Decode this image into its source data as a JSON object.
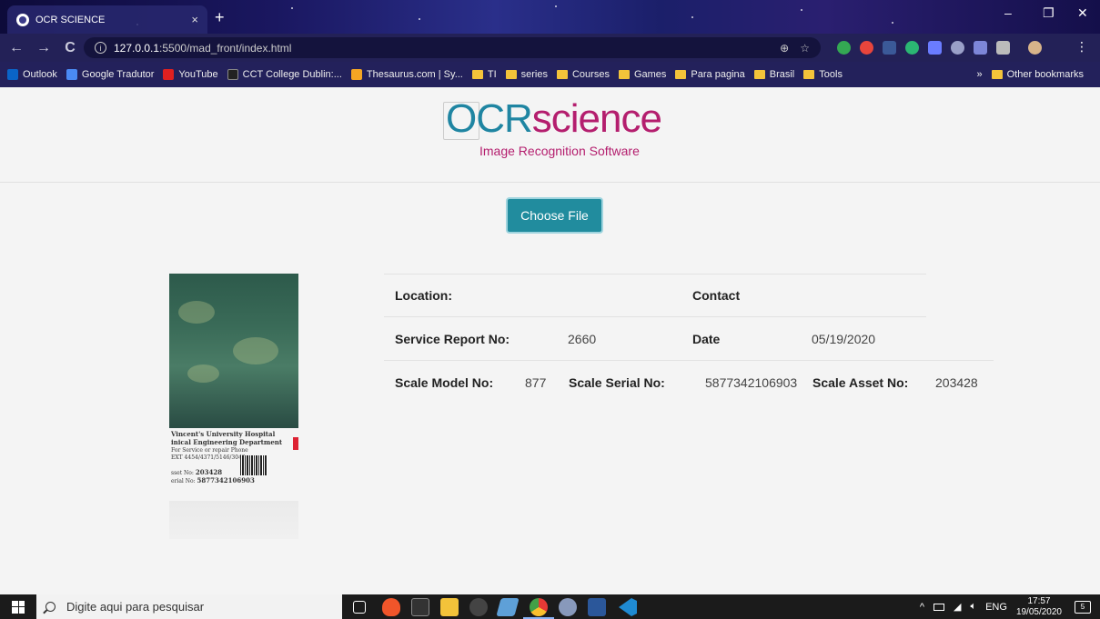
{
  "browser": {
    "tab_title": "OCR SCIENCE",
    "tab_close": "×",
    "new_tab": "+",
    "url_host": "127.0.0.1",
    "url_rest": ":5500/mad_front/index.html",
    "info_icon": "i",
    "nav": {
      "back": "←",
      "forward": "→",
      "reload": "C"
    },
    "window_controls": {
      "minimize": "–",
      "restore": "❐",
      "close": "✕"
    },
    "bookmarks": [
      {
        "label": "Outlook",
        "color": "#0a64c8"
      },
      {
        "label": "Google Tradutor",
        "color": "#4a8af4"
      },
      {
        "label": "YouTube",
        "color": "#e02020"
      },
      {
        "label": "CCT College Dublin:...",
        "color": "#222222"
      },
      {
        "label": "Thesaurus.com | Sy...",
        "color": "#f5a623"
      }
    ],
    "bookmark_folders": [
      "TI",
      "series",
      "Courses",
      "Games",
      "Para pagina",
      "Brasil",
      "Tools"
    ],
    "bookmarks_more": "»",
    "other_bookmarks": "Other bookmarks"
  },
  "header": {
    "logo_ocr": "OCR",
    "logo_science": "science",
    "logo_subtitle": "Image Recognition Software"
  },
  "upload": {
    "choose_label": "Choose File"
  },
  "photo": {
    "line1": "Vincent's University Hospital",
    "line2": "inical Engineering Department",
    "line3": "For Service or repair Phone",
    "line4": "EXT 4454/4371/5146/3043",
    "asset_label": "sset No:",
    "asset_value": "203428",
    "serial_label": "erial No:",
    "serial_value": "5877342106903"
  },
  "report": {
    "location_label": "Location:",
    "location_value": "",
    "contact_label": "Contact",
    "contact_value": "",
    "service_report_label": "Service Report No:",
    "service_report_value": "2660",
    "date_label": "Date",
    "date_value": "05/19/2020",
    "scale_model_label": "Scale Model No:",
    "scale_model_value": "877",
    "scale_serial_label": "Scale Serial No:",
    "scale_serial_value": "5877342106903",
    "scale_asset_label": "Scale Asset No:",
    "scale_asset_value": "203428"
  },
  "taskbar": {
    "search_placeholder": "Digite aqui para pesquisar",
    "tray_arrow": "^",
    "language": "ENG",
    "time": "17:57",
    "date": "19/05/2020",
    "notification_count": "5"
  }
}
